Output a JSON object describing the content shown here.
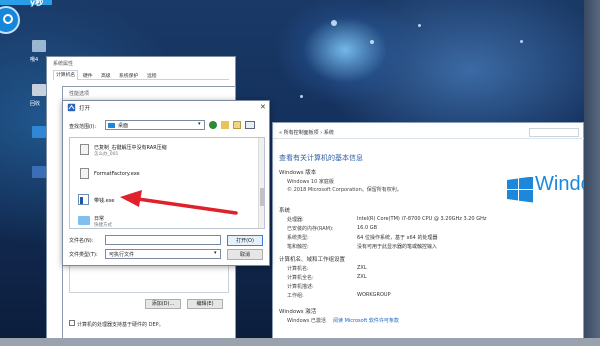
{
  "step_badge": {
    "text": "ÿ秒"
  },
  "desktop": {
    "icons": [
      {
        "label": "哦4"
      },
      {
        "label": "回收"
      },
      {
        "label": ""
      },
      {
        "label": ""
      }
    ]
  },
  "system_window": {
    "breadcrumb": "« 所有控制面板项 › 系统",
    "heading": "查看有关计算机的基本信息",
    "windows_edition_section": "Windows 版本",
    "edition": "Windows 10 家庭版",
    "copyright": "© 2018 Microsoft Corporation。保留所有权利。",
    "system_section": "系统",
    "rows": [
      {
        "label": "处理器:",
        "value": "Intel(R) Core(TM) i7-8700 CPU @ 3.20GHz   3.20 GHz"
      },
      {
        "label": "已安装的内存(RAM):",
        "value": "16.0 GB"
      },
      {
        "label": "系统类型:",
        "value": "64 位操作系统，基于 x64 的处理器"
      },
      {
        "label": "笔和触控:",
        "value": "没有可用于此显示器的笔或触控输入"
      }
    ],
    "computer_section": "计算机名、域和工作组设置",
    "computer_rows": [
      {
        "label": "计算机名:",
        "value": "ZXL"
      },
      {
        "label": "计算机全名:",
        "value": "ZXL"
      },
      {
        "label": "计算机描述:",
        "value": ""
      },
      {
        "label": "工作组:",
        "value": "WORKGROUP"
      }
    ],
    "activation_section": "Windows 激活",
    "activation_text": "Windows 已激活",
    "activation_link": "阅读 Microsoft 软件许可条款",
    "windows_logo_text": "Windo"
  },
  "properties_dialog": {
    "title": "系统属性",
    "tabs": [
      "计算机名",
      "硬件",
      "高级",
      "系统保护",
      "远程"
    ],
    "inner_title": "性能选项",
    "add_button": "添加(D)...",
    "edit_button": "编辑(E)",
    "footer_text": "计算机的处理器支持基于硬件的 DEP。"
  },
  "open_dialog": {
    "title": "打开",
    "look_in_label": "查找范围(I):",
    "look_in_value": "桌面",
    "files": [
      {
        "name": "已复制_右键解压中没有RAR压缩",
        "sub": "怎么办_001"
      },
      {
        "name": "FormatFactory.exe",
        "sub": ""
      },
      {
        "name": "带钱.exe",
        "sub": ""
      },
      {
        "name": "日常",
        "sub": "快捷方式"
      }
    ],
    "filename_label": "文件名(N):",
    "filename_value": "",
    "filetype_label": "文件类型(T):",
    "filetype_value": "可执行文件",
    "open_button": "打开(O)",
    "cancel_button": "取消"
  },
  "arrow": {
    "color": "#e0202a"
  }
}
